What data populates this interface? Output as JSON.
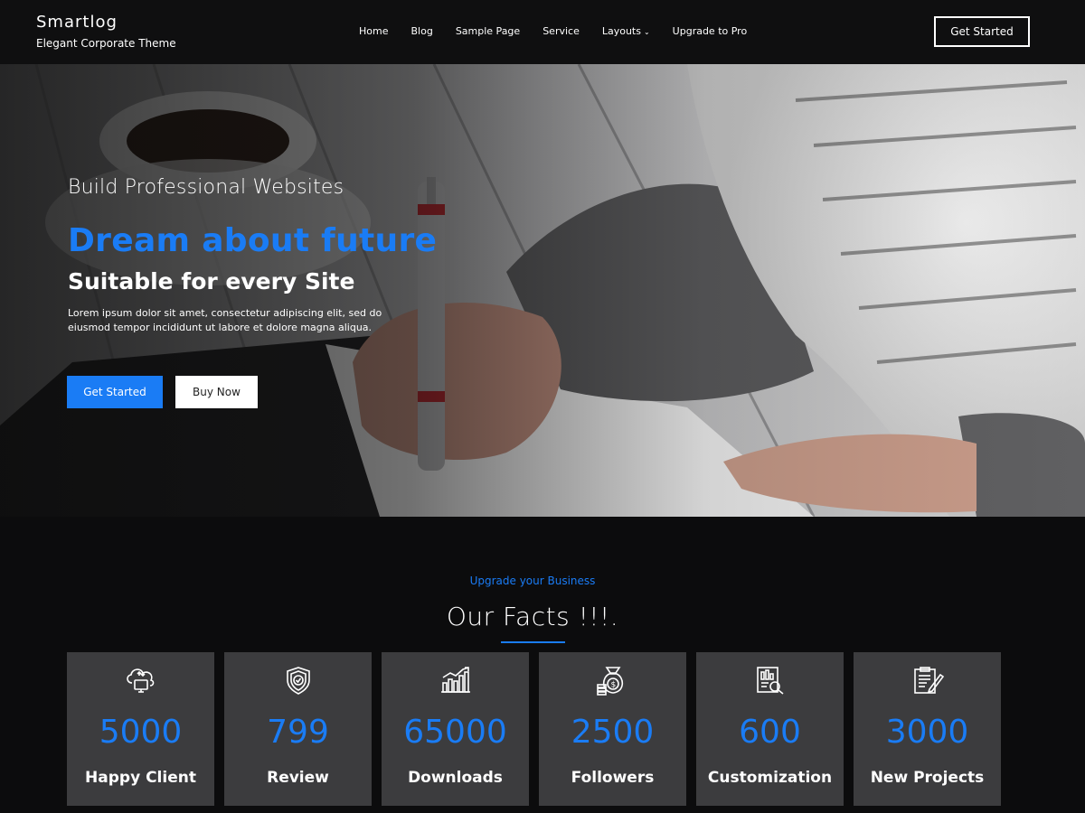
{
  "header": {
    "site_title": "Smartlog",
    "tagline": "Elegant Corporate Theme",
    "nav": [
      {
        "label": "Home"
      },
      {
        "label": "Blog"
      },
      {
        "label": "Sample Page"
      },
      {
        "label": "Service"
      },
      {
        "label": "Layouts"
      },
      {
        "label": "Upgrade to Pro"
      }
    ],
    "cta_label": "Get Started"
  },
  "hero": {
    "kicker": "Build Professional Websites",
    "title": "Dream about future",
    "subtitle": "Suitable for every Site",
    "description": "Lorem ipsum dolor sit amet, consectetur adipiscing elit, sed do eiusmod tempor incididunt ut labore et dolore magna aliqua.",
    "primary_button": "Get Started",
    "secondary_button": "Buy Now"
  },
  "facts": {
    "kicker": "Upgrade your Business",
    "title": "Our Facts !!!.",
    "items": [
      {
        "icon": "cloud-device-icon",
        "value": "5000",
        "label": "Happy Client"
      },
      {
        "icon": "shield-check-icon",
        "value": "799",
        "label": "Review"
      },
      {
        "icon": "bar-chart-icon",
        "value": "65000",
        "label": "Downloads"
      },
      {
        "icon": "money-bag-icon",
        "value": "2500",
        "label": "Followers"
      },
      {
        "icon": "report-search-icon",
        "value": "600",
        "label": "Customization"
      },
      {
        "icon": "document-pen-icon",
        "value": "3000",
        "label": "New Projects"
      }
    ]
  },
  "colors": {
    "accent": "#1a7cf5",
    "header_bg": "#0f0f10",
    "card_bg": "#3c3c3e"
  }
}
